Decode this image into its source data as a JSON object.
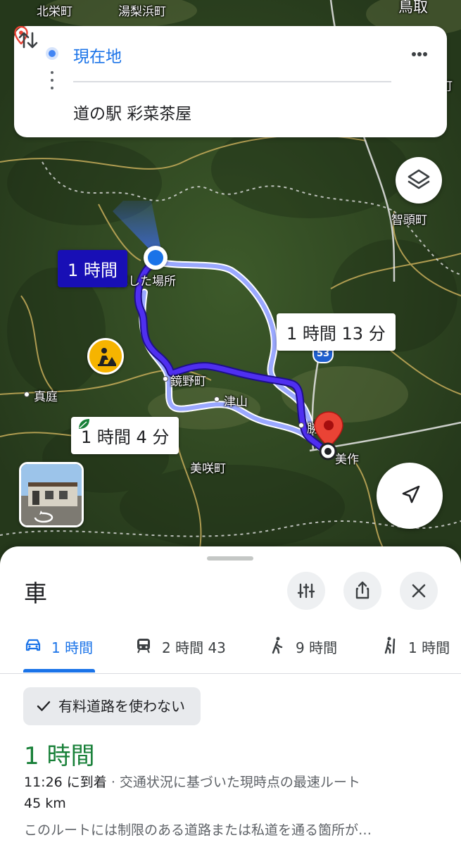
{
  "map": {
    "place_labels": [
      "北栄町",
      "湯梨浜町",
      "鳥取",
      "町",
      "智頭町",
      "真庭",
      "鏡野町",
      "津山",
      "美咲町",
      "美作",
      "駐車した場所",
      "勝町"
    ],
    "highway_number": "53",
    "route_primary_time": "1 時間",
    "route_alt1_time": "1 時間 13 分",
    "route_alt2_time": "1 時間 4 分",
    "route_color": "#3b1fd6",
    "alt_route_color": "#9aa8ff"
  },
  "search": {
    "origin": "現在地",
    "destination": "道の駅 彩菜茶屋"
  },
  "sheet": {
    "mode_title": "車",
    "tabs": [
      {
        "icon": "car-icon",
        "label": "1 時間"
      },
      {
        "icon": "transit-icon",
        "label": "2 時間 43"
      },
      {
        "icon": "walk-icon",
        "label": "9 時間"
      },
      {
        "icon": "hike-icon",
        "label": "1 時間"
      }
    ],
    "chip_label": "有料道路を使わない",
    "duration": "1 時間",
    "arrival": "11:26 に到着",
    "arrival_desc": " · 交通状況に基づいた現時点の最速ルート",
    "distance": "45 km",
    "warning": "このルートには制限のある道路または私道を通る箇所が…"
  },
  "colors": {
    "accent": "#1a73e8",
    "green": "#188038"
  }
}
